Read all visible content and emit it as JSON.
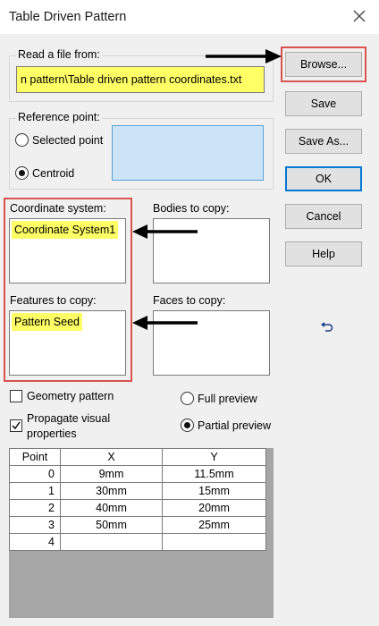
{
  "window": {
    "title": "Table Driven Pattern",
    "close_icon": "close-icon"
  },
  "file_group": {
    "label": "Read a file from:",
    "path_value": "n pattern\\Table driven pattern coordinates.txt"
  },
  "reference_group": {
    "label": "Reference point:",
    "options": [
      {
        "label": "Selected point",
        "checked": false
      },
      {
        "label": "Centroid",
        "checked": true
      }
    ]
  },
  "coordinate_system": {
    "label": "Coordinate system:",
    "selected": "Coordinate System1"
  },
  "bodies_to_copy": {
    "label": "Bodies to copy:"
  },
  "features_to_copy": {
    "label": "Features to copy:",
    "selected": "Pattern Seed"
  },
  "faces_to_copy": {
    "label": "Faces to copy:"
  },
  "buttons": {
    "browse": "Browse...",
    "save": "Save",
    "save_as": "Save As...",
    "ok": "OK",
    "cancel": "Cancel",
    "help": "Help"
  },
  "options": {
    "geometry_pattern": {
      "label": "Geometry pattern",
      "checked": false
    },
    "propagate_visual": {
      "label_line1": "Propagate visual",
      "label_line2": "properties",
      "checked": true
    },
    "full_preview": {
      "label": "Full preview",
      "checked": false
    },
    "partial_preview": {
      "label": "Partial preview",
      "checked": true
    }
  },
  "table": {
    "headers": [
      "Point",
      "X",
      "Y"
    ],
    "rows": [
      [
        "0",
        "9mm",
        "11.5mm"
      ],
      [
        "1",
        "30mm",
        "15mm"
      ],
      [
        "2",
        "40mm",
        "20mm"
      ],
      [
        "3",
        "50mm",
        "25mm"
      ],
      [
        "4",
        "",
        ""
      ]
    ]
  },
  "colors": {
    "highlight": "#ffff66",
    "callout_border": "#d9534f",
    "default_button_border": "#0078d7",
    "reference_box": "#cce4f7"
  },
  "icons": {
    "close": "close-icon",
    "undo": "undo-icon",
    "arrow": "arrow-left-icon",
    "check": "checkmark-icon"
  }
}
